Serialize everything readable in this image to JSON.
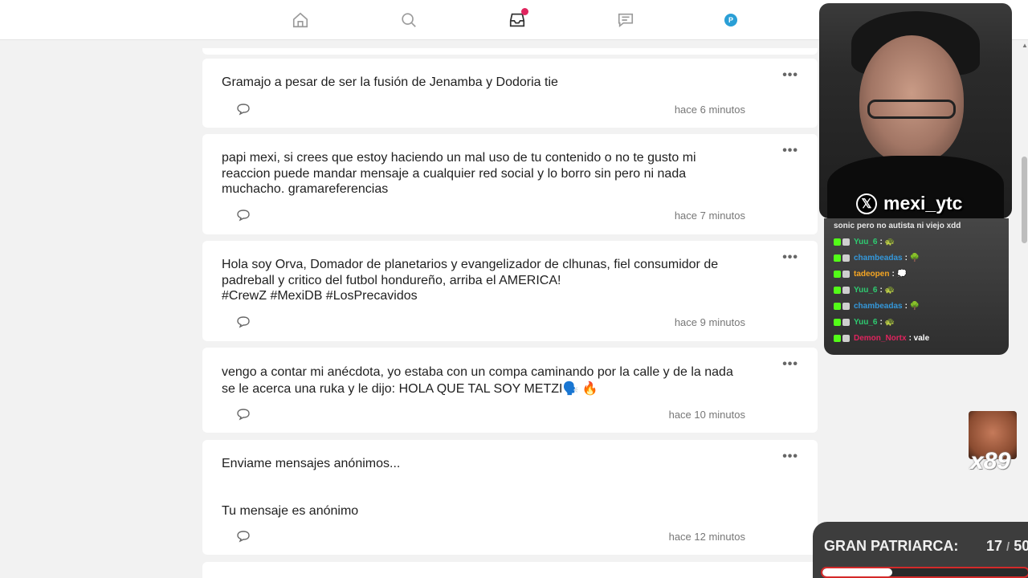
{
  "nav": {
    "icons": [
      "home-icon",
      "search-icon",
      "inbox-icon",
      "messages-icon",
      "profile-avatar"
    ],
    "avatar_letter": "P",
    "notification_color": "#e0245e"
  },
  "posts": [
    {
      "text": "Gramajo a pesar de ser la fusión de Jenamba y Dodoria tie",
      "time": "hace 6 minutos"
    },
    {
      "text": "papi mexi, si crees que estoy haciendo un mal uso de tu contenido o no te gusto mi reaccion puede mandar mensaje a cualquier red social y lo borro sin pero ni nada muchacho. gramareferencias",
      "time": "hace 7 minutos"
    },
    {
      "text": "Hola soy Orva, Domador de planetarios y evangelizador de clhunas, fiel consumidor de padreball y critico del futbol hondureño, arriba el AMERICA!\n#CrewZ #MexiDB #LosPrecavidos",
      "time": "hace 9 minutos"
    },
    {
      "text": "vengo a contar mi anécdota, yo estaba con un compa caminando por la calle y de la nada se le acerca una ruka y le dijo: HOLA QUE TAL SOY METZI🗣️ 🔥",
      "time": "hace 10 minutos"
    },
    {
      "text": "Enviame mensajes anónimos...\n\n\nTu mensaje es anónimo",
      "time": "hace 12 minutos"
    }
  ],
  "more_glyph": "•••",
  "stream": {
    "x_logo": "𝕏",
    "handle": "mexi_ytc",
    "chat_top": "sonic pero no autista ni viejo xdd",
    "chat": [
      {
        "user": "Yuu_6",
        "msg": ": 🐢",
        "color": "#2ecc71"
      },
      {
        "user": "chambeadas",
        "msg": ": 🌳",
        "color": "#3498db"
      },
      {
        "user": "tadeopen",
        "msg": ": 💭",
        "color": "#f5a623"
      },
      {
        "user": "Yuu_6",
        "msg": ": 🐢",
        "color": "#2ecc71"
      },
      {
        "user": "chambeadas",
        "msg": ": 🌳",
        "color": "#3498db"
      },
      {
        "user": "Yuu_6",
        "msg": ": 🐢",
        "color": "#2ecc71"
      },
      {
        "user": "Demon_Nortx",
        "msg": ": vale",
        "color": "#e0245e"
      }
    ],
    "emote_count": "x89",
    "goal_label": "GRAN PATRIARCA:",
    "goal_current": "17",
    "goal_sep": "/",
    "goal_total": "50",
    "goal_progress": 0.34
  }
}
